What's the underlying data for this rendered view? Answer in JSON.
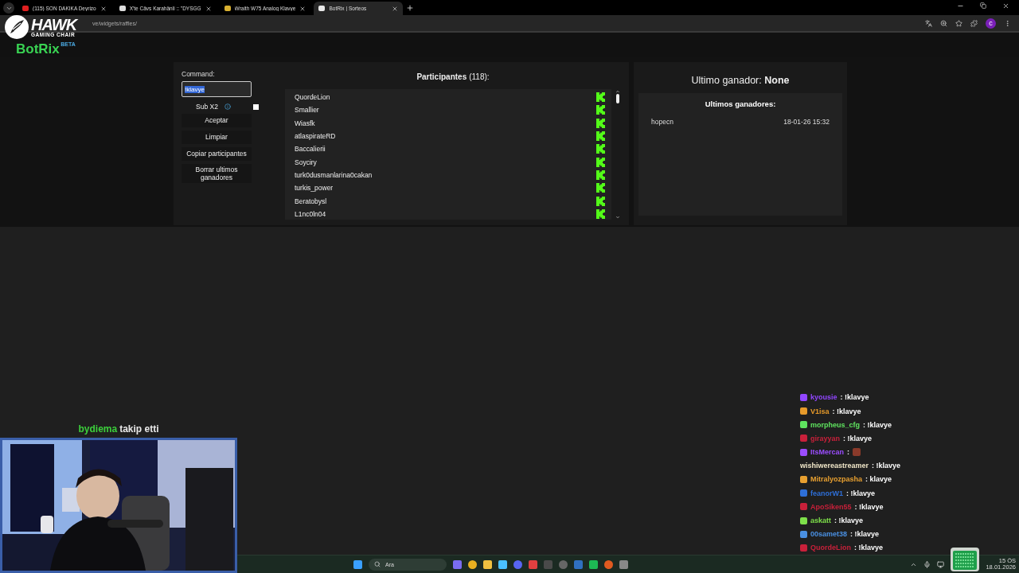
{
  "browser": {
    "tabs": [
      {
        "title": "(115) SON DAKİKA Deyrizo",
        "selected": false
      },
      {
        "title": "X'te Cävs Karahänli :: \"DYSGG",
        "selected": false
      },
      {
        "title": "Wraith W75 Analog Klavye",
        "selected": false
      },
      {
        "title": "BotRix | Sorteos",
        "selected": true
      }
    ],
    "url": "ve/widgets/raffles/",
    "profile_initial": "c"
  },
  "overlay_logo": {
    "brand": "HAWK",
    "tagline": "GAMING CHAIR"
  },
  "site": {
    "logo": "BotRix",
    "badge": "BETA"
  },
  "raffle": {
    "command_label": "Command:",
    "command_value": "!klavye",
    "value_selected": true,
    "sub_option": {
      "label": "Sub X2",
      "checked": false
    },
    "buttons": [
      "Aceptar",
      "Limpiar",
      "Copiar participantes",
      "Borrar ultimos ganadores"
    ],
    "participants_title": "Participantes",
    "participants_count": "(118):",
    "participants": [
      "QuordeLion",
      "Smallier",
      "Wiasfk",
      "atlaspirateRD",
      "Baccalierii",
      "Soyciry",
      "turk0dusmanlarina0cakan",
      "turkis_power",
      "Beratobysl",
      "L1nc0ln04"
    ]
  },
  "winner": {
    "title": "Ultimo ganador: **None**",
    "recent_title": "Ultimos ganadores:",
    "recent": [
      {
        "name": "hopecn",
        "date": "18-01-26 15:32"
      }
    ]
  },
  "follow_alert": {
    "user": "bydiema",
    "text": "takip etti"
  },
  "chat": [
    {
      "user": "kyousie",
      "color": "#9146ff",
      "badge": true,
      "kind": "text",
      "message": ": !klavye"
    },
    {
      "user": "V1isa",
      "color": "#e69a2a",
      "badge": true,
      "kind": "text",
      "message": ": !klavye"
    },
    {
      "user": "morpheus_cfg",
      "color": "#5fe35f",
      "badge": true,
      "kind": "text",
      "message": ": !klavye"
    },
    {
      "user": "girayyan",
      "color": "#c8203a",
      "badge": true,
      "kind": "text",
      "message": ": !klavye"
    },
    {
      "user": "ItsMercan",
      "color": "#9b4dff",
      "badge": true,
      "kind": "emote",
      "message": ":"
    },
    {
      "user": "wishiwereastreamer",
      "color": "#f0e6c8",
      "badge": false,
      "kind": "text",
      "message": ": !klavye"
    },
    {
      "user": "Mitralyozpasha",
      "color": "#e8a030",
      "badge": true,
      "kind": "text",
      "message": ": klavye"
    },
    {
      "user": "feanorW1",
      "color": "#2e6fd8",
      "badge": true,
      "kind": "text",
      "message": ": !klavye"
    },
    {
      "user": "ApoSiken55",
      "color": "#c8203a",
      "badge": true,
      "kind": "text",
      "message": ": !klavye"
    },
    {
      "user": "askatt",
      "color": "#7ee04a",
      "badge": true,
      "kind": "text",
      "message": ": !klavye"
    },
    {
      "user": "00samet38",
      "color": "#4a90e2",
      "badge": true,
      "kind": "text",
      "message": ": !klavye"
    },
    {
      "user": "QuordeLion",
      "color": "#c8203a",
      "badge": true,
      "kind": "text",
      "message": ": !klavye"
    }
  ],
  "taskbar": {
    "search_placeholder": "Ara",
    "clock_time": "15 ÖS",
    "clock_date": "18.01.2026"
  }
}
